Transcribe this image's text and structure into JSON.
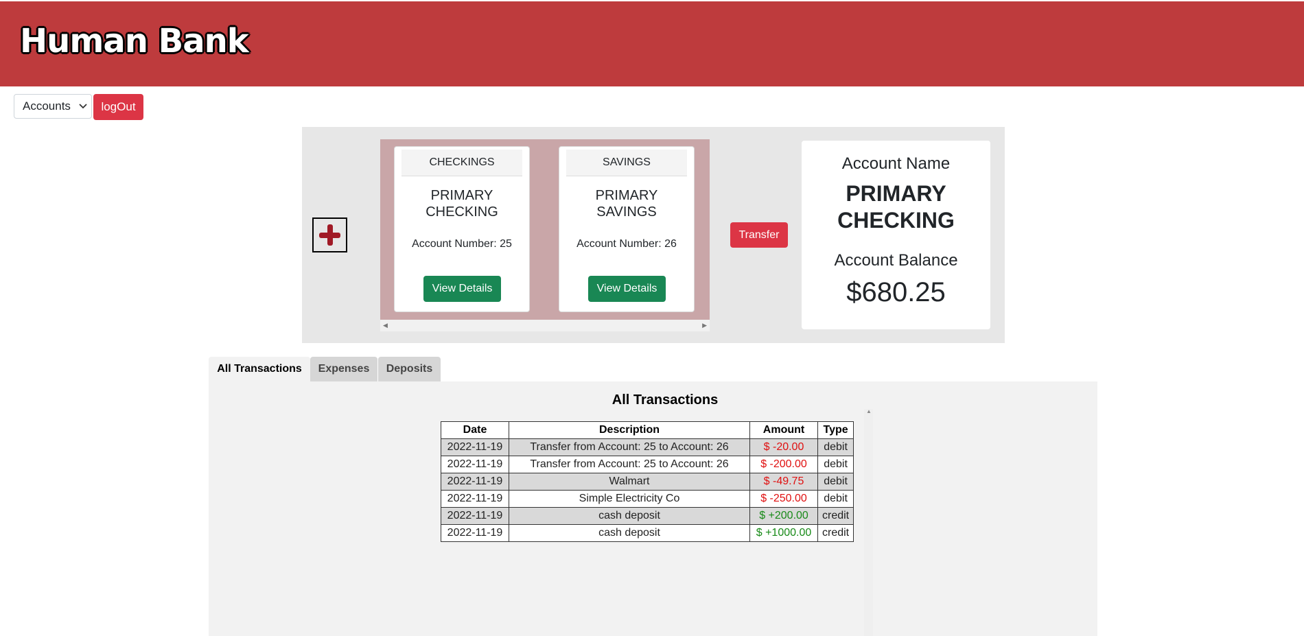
{
  "header": {
    "brand": "Human Bank",
    "brand_color": "#be3b3d"
  },
  "nav": {
    "accounts_label": "Accounts",
    "logout_label": "logOut"
  },
  "accounts": [
    {
      "type": "CHECKINGS",
      "name_line1": "PRIMARY",
      "name_line2": "CHECKING",
      "number_text": "Account Number: 25",
      "view_label": "View Details"
    },
    {
      "type": "SAVINGS",
      "name_line1": "PRIMARY",
      "name_line2": "SAVINGS",
      "number_text": "Account Number: 26",
      "view_label": "View Details"
    }
  ],
  "transfer_label": "Transfer",
  "summary": {
    "name_label": "Account Name",
    "name_line1": "PRIMARY",
    "name_line2": "CHECKING",
    "balance_label": "Account Balance",
    "balance": "$680.25"
  },
  "tabs": [
    {
      "label": "All Transactions",
      "active": true
    },
    {
      "label": "Expenses",
      "active": false
    },
    {
      "label": "Deposits",
      "active": false
    }
  ],
  "transactions": {
    "title": "All Transactions",
    "headers": [
      "Date",
      "Description",
      "Amount",
      "Type"
    ],
    "rows": [
      {
        "date": "2022-11-19",
        "description": "Transfer from Account: 25 to Account: 26",
        "amount": "$ -20.00",
        "type": "debit"
      },
      {
        "date": "2022-11-19",
        "description": "Transfer from Account: 25 to Account: 26",
        "amount": "$ -200.00",
        "type": "debit"
      },
      {
        "date": "2022-11-19",
        "description": "Walmart",
        "amount": "$ -49.75",
        "type": "debit"
      },
      {
        "date": "2022-11-19",
        "description": "Simple Electricity Co",
        "amount": "$ -250.00",
        "type": "debit"
      },
      {
        "date": "2022-11-19",
        "description": "cash deposit",
        "amount": "$ +200.00",
        "type": "credit"
      },
      {
        "date": "2022-11-19",
        "description": "cash deposit",
        "amount": "$ +1000.00",
        "type": "credit"
      }
    ]
  },
  "colors": {
    "debit": "#e01010",
    "credit": "#188a18",
    "view_button": "#198754",
    "danger_button": "#dc3545"
  }
}
